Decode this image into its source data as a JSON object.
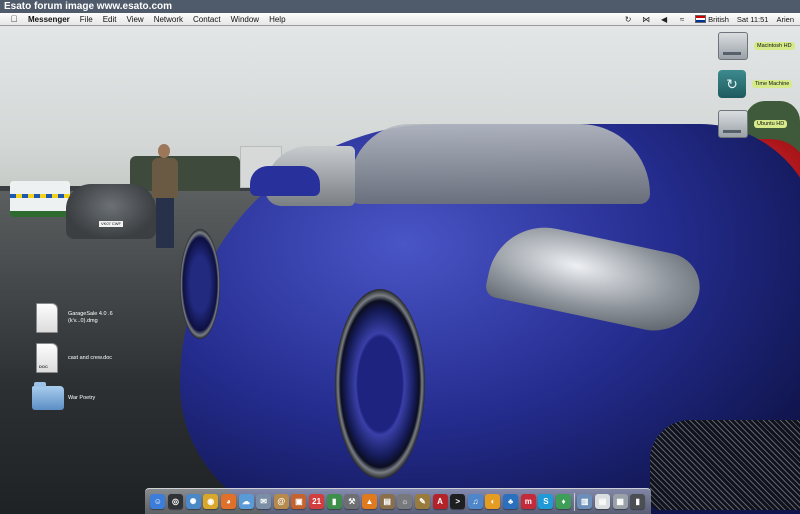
{
  "watermark": {
    "text": "Esato forum image www.esato.com"
  },
  "menubar": {
    "apple_glyph": "",
    "app_name": "Messenger",
    "menus": [
      "File",
      "Edit",
      "View",
      "Network",
      "Contact",
      "Window",
      "Help"
    ],
    "status": {
      "time_machine_icon": "time-machine-icon",
      "bluetooth_icon": "bluetooth-icon",
      "volume_icon": "volume-icon",
      "wifi_icon": "wifi-icon",
      "input_source_label": "British",
      "clock": "Sat 11:51",
      "user_name": "Arien"
    }
  },
  "desktop": {
    "drives": [
      {
        "label": "Macintosh HD",
        "icon": "hard-drive-icon"
      },
      {
        "label": "Time Machine",
        "icon": "time-machine-icon"
      },
      {
        "label": "Ubuntu HD",
        "icon": "hard-drive-icon"
      }
    ],
    "files": [
      {
        "label": "GarageSale 4.0 .6 (k'v...0).dmg",
        "icon": "disk-image-icon",
        "tag": ""
      },
      {
        "label": "cast and crew.doc",
        "icon": "document-icon",
        "tag": "DOC"
      },
      {
        "label": "War Poetry",
        "icon": "folder-icon",
        "tag": ""
      }
    ],
    "wallpaper_plates": {
      "gray_car_plate": "VK07 CWF"
    }
  },
  "dock": {
    "items": [
      {
        "name": "finder",
        "glyph": "☺",
        "color": "#3b7dd8"
      },
      {
        "name": "dashboard",
        "glyph": "◎",
        "color": "#2f3338"
      },
      {
        "name": "safari",
        "glyph": "✺",
        "color": "#4a88c8"
      },
      {
        "name": "chrome",
        "glyph": "◉",
        "color": "#d9a72b"
      },
      {
        "name": "firefox",
        "glyph": "◕",
        "color": "#e0702a"
      },
      {
        "name": "ichat",
        "glyph": "☁",
        "color": "#5a9ad6"
      },
      {
        "name": "mail",
        "glyph": "✉",
        "color": "#7a8fa5"
      },
      {
        "name": "address-book",
        "glyph": "@",
        "color": "#b58a4c"
      },
      {
        "name": "photo",
        "glyph": "▣",
        "color": "#c4632f"
      },
      {
        "name": "ical",
        "glyph": "21",
        "color": "#d23d3d"
      },
      {
        "name": "charts",
        "glyph": "▮",
        "color": "#3f8f4a"
      },
      {
        "name": "utility",
        "glyph": "⚒",
        "color": "#6d6f72"
      },
      {
        "name": "vlc",
        "glyph": "▲",
        "color": "#e07a1f"
      },
      {
        "name": "preview",
        "glyph": "▤",
        "color": "#8a6f4c"
      },
      {
        "name": "system-preferences",
        "glyph": "☼",
        "color": "#77797c"
      },
      {
        "name": "tools",
        "glyph": "✎",
        "color": "#9a7b3e"
      },
      {
        "name": "acrobat",
        "glyph": "A",
        "color": "#b3242a"
      },
      {
        "name": "terminal",
        "glyph": ">",
        "color": "#1e1f21"
      },
      {
        "name": "itunes",
        "glyph": "♫",
        "color": "#4f86c9"
      },
      {
        "name": "vlc-2",
        "glyph": "◐",
        "color": "#e59c22"
      },
      {
        "name": "messenger",
        "glyph": "♣",
        "color": "#2b6fbf"
      },
      {
        "name": "media",
        "glyph": "m",
        "color": "#c22b3a"
      },
      {
        "name": "skype",
        "glyph": "S",
        "color": "#1f9ad6"
      },
      {
        "name": "adium",
        "glyph": "♦",
        "color": "#3e9e57"
      }
    ],
    "right_items": [
      {
        "name": "applications-stack",
        "glyph": "▥",
        "color": "#6b8fb8"
      },
      {
        "name": "documents-stack",
        "glyph": "▤",
        "color": "#d9dde0"
      },
      {
        "name": "downloads-stack",
        "glyph": "▦",
        "color": "#9aa2a8"
      },
      {
        "name": "trash",
        "glyph": "▮",
        "color": "#4b4e52"
      }
    ]
  }
}
